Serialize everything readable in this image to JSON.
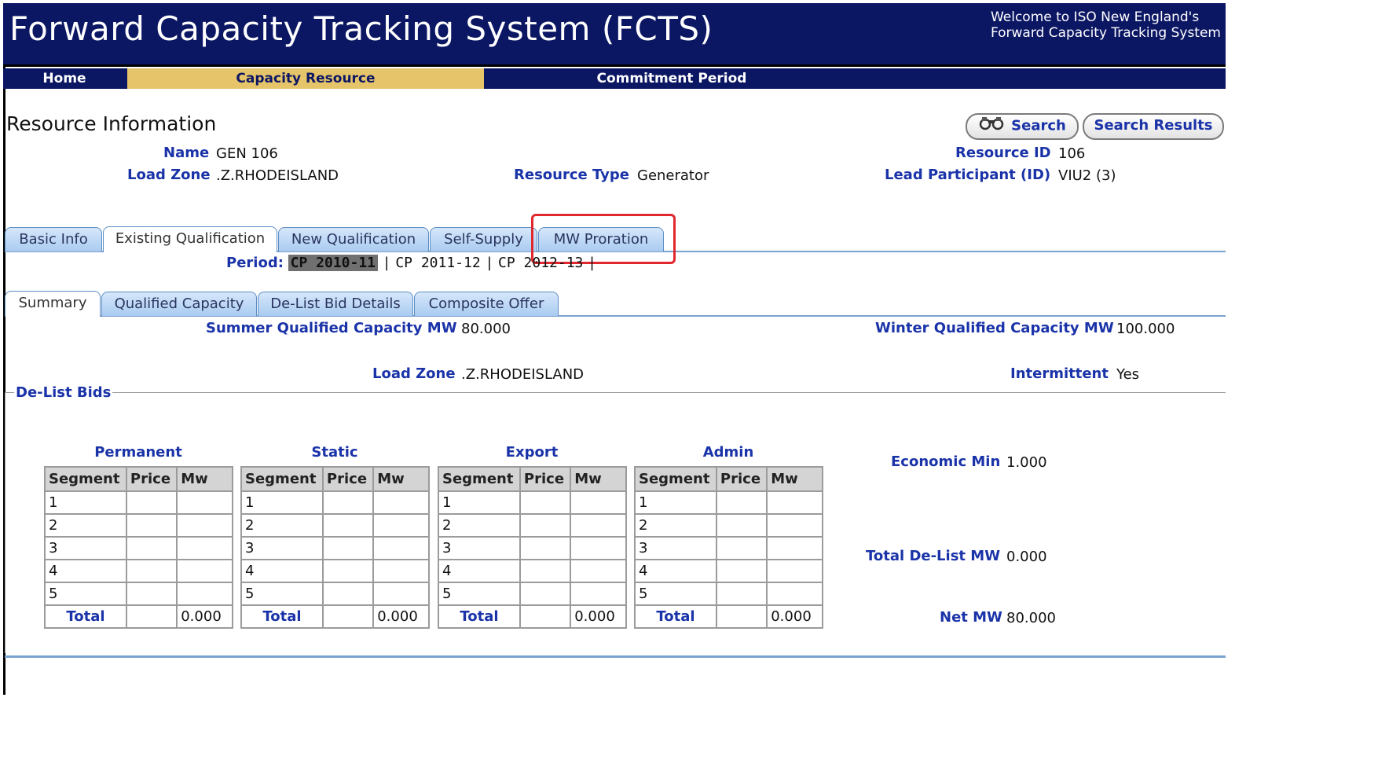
{
  "header": {
    "title": "Forward Capacity Tracking System (FCTS)",
    "welcome_line1": "Welcome to ISO New England's",
    "welcome_line2": "Forward Capacity Tracking System"
  },
  "nav": {
    "home": "Home",
    "capacity_resource": "Capacity Resource",
    "commitment_period": "Commitment Period"
  },
  "colors": {
    "header_bg": "#0c1764",
    "active_nav": "#e6c46a",
    "label_blue": "#1a33a8",
    "highlight": "#e0282e"
  },
  "resource": {
    "section_title": "Resource Information",
    "search_label": "Search",
    "search_results_label": "Search Results",
    "name_label": "Name",
    "name_value": "GEN 106",
    "load_zone_label": "Load Zone",
    "load_zone_value": ".Z.RHODEISLAND",
    "resource_type_label": "Resource Type",
    "resource_type_value": "Generator",
    "resource_id_label": "Resource ID",
    "resource_id_value": "106",
    "lead_participant_label": "Lead Participant (ID)",
    "lead_participant_value": "VIU2 (3)"
  },
  "tabs": [
    "Basic Info",
    "Existing Qualification",
    "New Qualification",
    "Self-Supply",
    "MW Proration"
  ],
  "period": {
    "label": "Period:",
    "selected": "CP 2010-11",
    "option2": "CP 2011-12",
    "option3": "CP 2012-13",
    "sep": "|"
  },
  "subtabs": [
    "Summary",
    "Qualified Capacity",
    "De-List Bid Details",
    "Composite Offer"
  ],
  "summary": {
    "summer_label": "Summer Qualified Capacity MW",
    "summer_value": "80.000",
    "winter_label": "Winter Qualified Capacity MW",
    "winter_value": "100.000",
    "load_zone_label": "Load Zone",
    "load_zone_value": ".Z.RHODEISLAND",
    "intermittent_label": "Intermittent",
    "intermittent_value": "Yes"
  },
  "delist": {
    "legend": "De-List Bids",
    "columns": [
      "Segment",
      "Price",
      "Mw"
    ],
    "segments": [
      "1",
      "2",
      "3",
      "4",
      "5"
    ],
    "total_label": "Total",
    "tables": [
      {
        "title": "Permanent",
        "total_mw": "0.000"
      },
      {
        "title": "Static",
        "total_mw": "0.000"
      },
      {
        "title": "Export",
        "total_mw": "0.000"
      },
      {
        "title": "Admin",
        "total_mw": "0.000"
      }
    ],
    "economic_min_label": "Economic Min",
    "economic_min_value": "1.000",
    "total_delist_label": "Total De-List MW",
    "total_delist_value": "0.000",
    "net_mw_label": "Net MW",
    "net_mw_value": "80.000"
  }
}
